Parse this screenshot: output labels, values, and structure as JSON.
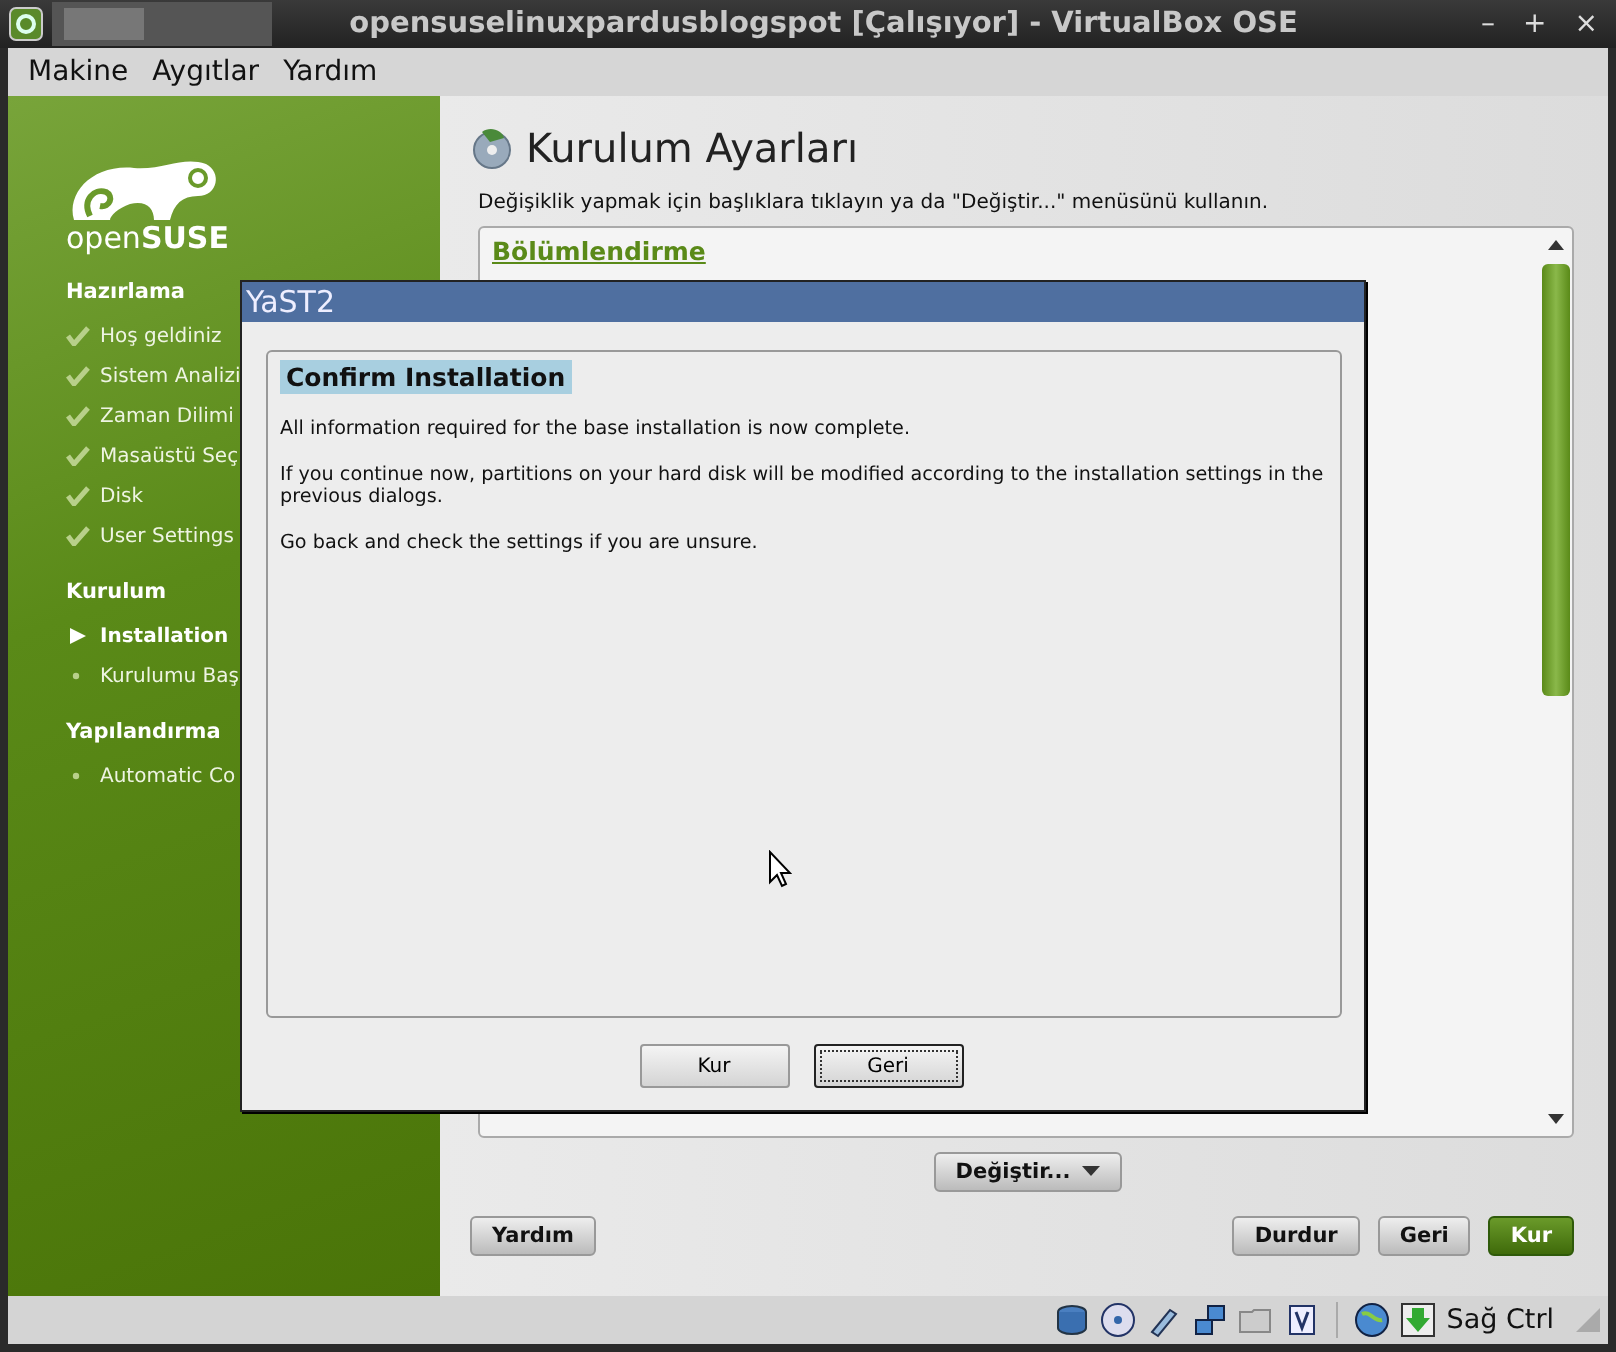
{
  "window": {
    "title": "opensuselinuxpardusblogspot [Çalışıyor] - VirtualBox OSE",
    "controls": [
      "–",
      "+",
      "×"
    ]
  },
  "menu": [
    "Makine",
    "Aygıtlar",
    "Yardım"
  ],
  "sidebar": {
    "logo": "open**SUSE**",
    "sections": [
      {
        "title": "Hazırlama",
        "items": [
          {
            "label": "Hoş geldiniz",
            "kind": "done"
          },
          {
            "label": "Sistem Analizi",
            "kind": "done"
          },
          {
            "label": "Zaman Dilimi",
            "kind": "done"
          },
          {
            "label": "Masaüstü Seç",
            "kind": "done"
          },
          {
            "label": "Disk",
            "kind": "done"
          },
          {
            "label": "User Settings",
            "kind": "done"
          }
        ]
      },
      {
        "title": "Kurulum",
        "items": [
          {
            "label": "Installation",
            "kind": "current"
          },
          {
            "label": "Kurulumu Baş",
            "kind": "pending"
          }
        ]
      },
      {
        "title": "Yapılandırma",
        "items": [
          {
            "label": "Automatic Co",
            "kind": "pending"
          }
        ]
      }
    ]
  },
  "main": {
    "title": "Kurulum Ayarları",
    "description": "Değişiklik yapmak için başlıklara tıklayın ya da \"Değiştir...\" menüsünü kullanın.",
    "list": {
      "heading": "Bölümlendirme"
    },
    "change_button": "Değiştir...",
    "help_button": "Yardım",
    "buttons": [
      {
        "label": "Durdur",
        "primary": false
      },
      {
        "label": "Geri",
        "primary": false
      },
      {
        "label": "Kur",
        "primary": true
      }
    ]
  },
  "dialog": {
    "title": "YaST2",
    "heading": "Confirm Installation",
    "paragraphs": [
      "All information required for the base installation is now complete.",
      "If you continue now, partitions on your hard disk will be modified according to the installation settings in the previous dialogs.",
      "Go back and check the settings if you are unsure."
    ],
    "buttons": [
      {
        "label": "Kur",
        "focused": false
      },
      {
        "label": "Geri",
        "focused": true
      }
    ]
  },
  "status_bar": {
    "host_key": "Sağ Ctrl"
  }
}
